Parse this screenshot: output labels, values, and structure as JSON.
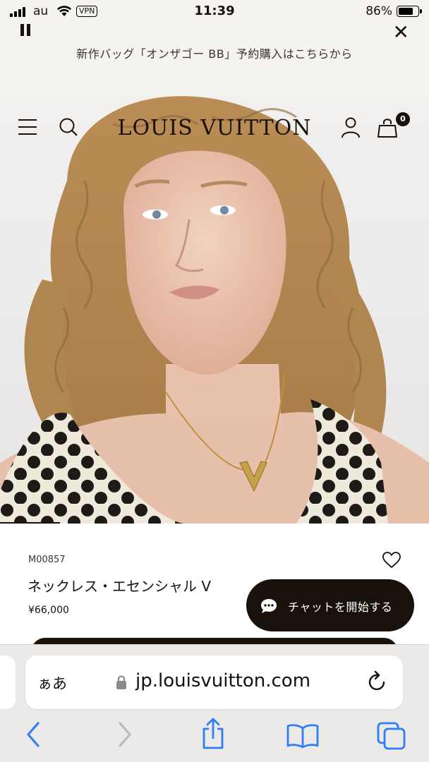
{
  "status_bar": {
    "carrier": "au",
    "vpn": "VPN",
    "time": "11:39",
    "battery": "86%",
    "battery_level": 0.86
  },
  "promo_banner": {
    "text": "新作バッグ「オンザゴー BB」予約購入はこちらから",
    "pause_icon": "pause-icon",
    "close_icon": "close-icon"
  },
  "header": {
    "brand": "LOUIS VUITTON",
    "menu_icon": "hamburger-menu-icon",
    "search_icon": "search-icon",
    "account_icon": "user-icon",
    "cart_icon": "shopping-bag-icon",
    "cart_count": "0"
  },
  "hero": {
    "image": "model wearing gold V pendant necklace and polka dot top",
    "carousel_progress": 0.14
  },
  "product": {
    "sku": "M00857",
    "name": "ネックレス・エセンシャル V",
    "price": "¥66,000",
    "wishlist_icon": "heart-icon"
  },
  "chat": {
    "label": "チャットを開始する",
    "icon": "chat-bubble-icon"
  },
  "browser": {
    "aa_label": "ぁあ",
    "url": "jp.louisvuitton.com",
    "lock_icon": "lock-icon",
    "reload_icon": "reload-icon",
    "toolbar": [
      "back-icon",
      "forward-icon",
      "share-icon",
      "bookmarks-icon",
      "tabs-icon"
    ]
  },
  "colors": {
    "lv_dark": "#19110b",
    "banner_bg": "#f5f3f0",
    "safari_blue": "#2f7ef6"
  }
}
